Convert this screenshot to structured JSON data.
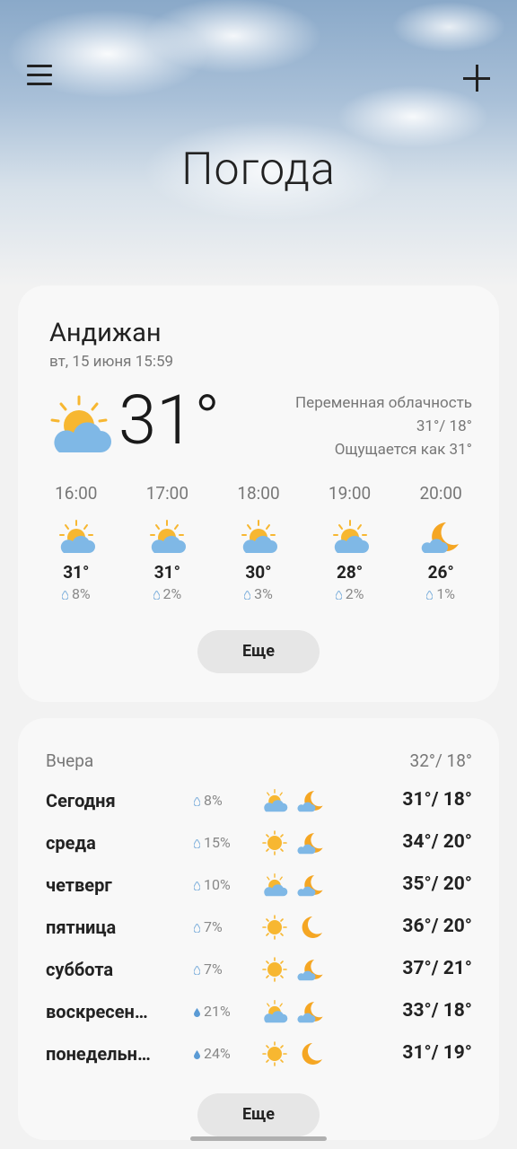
{
  "app": {
    "title": "Погода"
  },
  "current": {
    "city": "Андижан",
    "datetime": "вт, 15 июня 15:59",
    "temp": "31°",
    "condition": "Переменная облачность",
    "high_low": "31°/ 18°",
    "feels_like": "Ощущается как 31°"
  },
  "hourly": [
    {
      "time": "16:00",
      "icon": "partly-cloudy-day-icon",
      "temp": "31°",
      "rain": "8%"
    },
    {
      "time": "17:00",
      "icon": "partly-cloudy-day-icon",
      "temp": "31°",
      "rain": "2%"
    },
    {
      "time": "18:00",
      "icon": "partly-cloudy-day-icon",
      "temp": "30°",
      "rain": "3%"
    },
    {
      "time": "19:00",
      "icon": "partly-cloudy-day-icon",
      "temp": "28°",
      "rain": "2%"
    },
    {
      "time": "20:00",
      "icon": "partly-cloudy-night-icon",
      "temp": "26°",
      "rain": "1%"
    }
  ],
  "more_label": "Еще",
  "daily": {
    "yesterday_label": "Вчера",
    "yesterday_temp": "32°/ 18°",
    "days": [
      {
        "name": "Сегодня",
        "rain": "8%",
        "day_icon": "partly-cloudy-day-icon",
        "night_icon": "partly-cloudy-night-icon",
        "temp": "31°/ 18°"
      },
      {
        "name": "среда",
        "rain": "15%",
        "day_icon": "sunny-icon",
        "night_icon": "partly-cloudy-night-icon",
        "temp": "34°/ 20°"
      },
      {
        "name": "четверг",
        "rain": "10%",
        "day_icon": "partly-cloudy-day-icon",
        "night_icon": "partly-cloudy-night-icon",
        "temp": "35°/ 20°"
      },
      {
        "name": "пятница",
        "rain": "7%",
        "day_icon": "sunny-icon",
        "night_icon": "moon-icon",
        "temp": "36°/ 20°"
      },
      {
        "name": "суббота",
        "rain": "7%",
        "day_icon": "sunny-icon",
        "night_icon": "partly-cloudy-night-icon",
        "temp": "37°/ 21°"
      },
      {
        "name": "воскресен…",
        "rain": "21%",
        "day_icon": "partly-cloudy-day-icon",
        "night_icon": "partly-cloudy-night-icon",
        "temp": "33°/ 18°"
      },
      {
        "name": "понедельн…",
        "rain": "24%",
        "day_icon": "sunny-icon",
        "night_icon": "moon-icon",
        "temp": "31°/ 19°"
      }
    ]
  },
  "colors": {
    "sun": "#f7b731",
    "cloud": "#7fb8e6",
    "moon": "#f5a623",
    "drop_light": "#a9c9e8",
    "drop_dark": "#5b9bd5"
  }
}
